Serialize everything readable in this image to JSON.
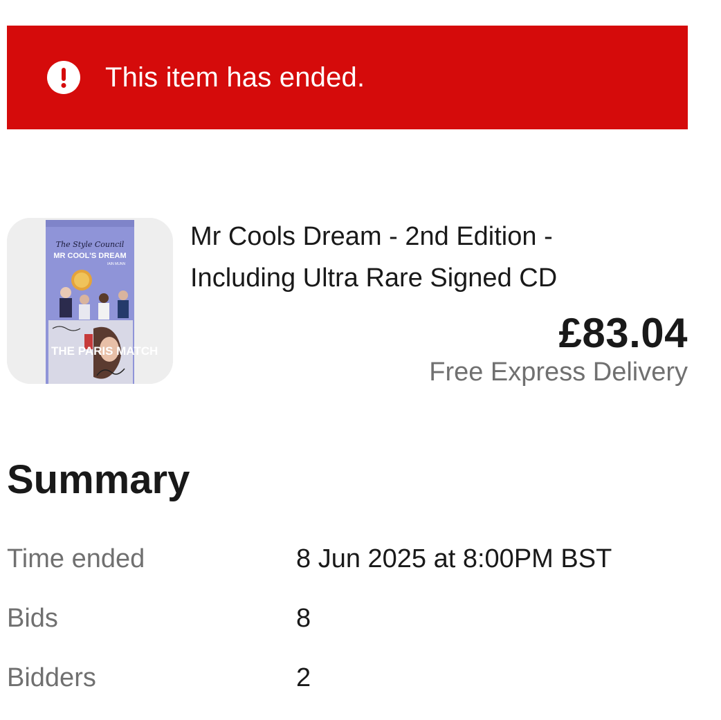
{
  "banner": {
    "message": "This item has ended.",
    "icon": "alert-circle-icon",
    "background_color": "#d50b0b"
  },
  "product": {
    "title_line1": "Mr Cools Dream - 2nd Edition -",
    "title_line2": "Including Ultra Rare Signed CD",
    "price": "£83.04",
    "delivery": "Free Express Delivery",
    "image": {
      "icon": "product-thumbnail",
      "cover_text_top": "The Style Council",
      "cover_text_title": "MR COOL'S DREAM",
      "cover_text_author": "IAIN MUNN",
      "cd_text": "THE PARIS MATCH"
    }
  },
  "summary": {
    "heading": "Summary",
    "rows": [
      {
        "label": "Time ended",
        "value": "8 Jun 2025 at 8:00PM BST"
      },
      {
        "label": "Bids",
        "value": "8"
      },
      {
        "label": "Bidders",
        "value": "2"
      }
    ]
  }
}
